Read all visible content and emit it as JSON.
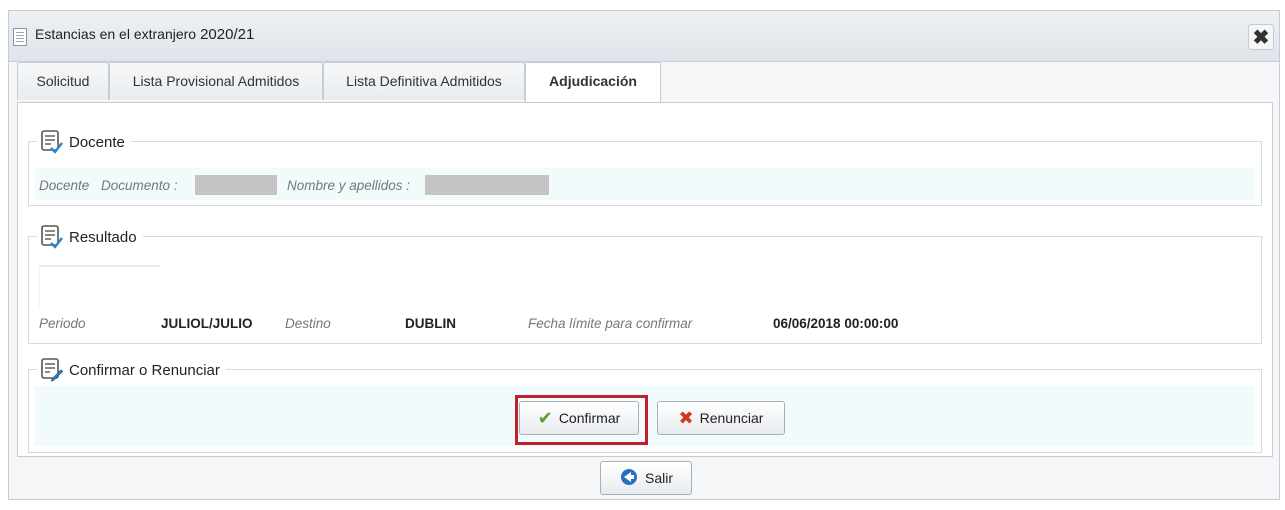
{
  "window": {
    "title": "Estancias en el extranjero",
    "year": "2020/21",
    "close_icon": "close-x-icon"
  },
  "tabs": [
    {
      "label": "Solicitud",
      "active": false
    },
    {
      "label": "Lista Provisional Admitidos",
      "active": false
    },
    {
      "label": "Lista Definitiva Admitidos",
      "active": false
    },
    {
      "label": "Adjudicación",
      "active": true
    }
  ],
  "docente": {
    "legend": "Docente",
    "label": "Docente",
    "documento_label": "Documento :",
    "nombre_label": "Nombre y apellidos :"
  },
  "resultado": {
    "legend": "Resultado",
    "periodo_label": "Periodo",
    "periodo_value": "JULIOL/JULIO",
    "destino_label": "Destino",
    "destino_value": "DUBLIN",
    "fecha_label": "Fecha límite para confirmar",
    "fecha_value": "06/06/2018 00:00:00"
  },
  "confirmar": {
    "legend": "Confirmar o Renunciar",
    "confirm_label": "Confirmar",
    "renounce_label": "Renunciar"
  },
  "footer": {
    "exit_label": "Salir"
  },
  "colors": {
    "highlight": "#c0202a",
    "tint": "#f2fbfc",
    "check": "#5aa02c",
    "cross": "#d03a1e",
    "exit_arrow": "#2a6fbf"
  }
}
